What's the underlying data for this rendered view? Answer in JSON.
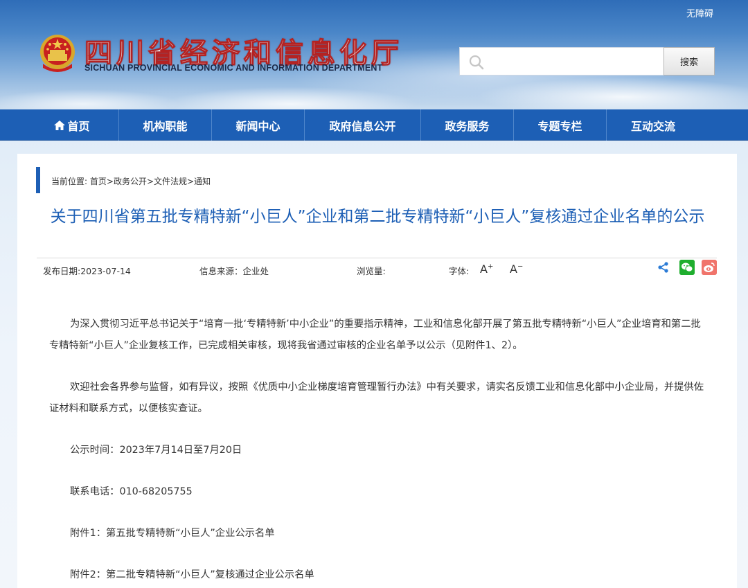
{
  "header": {
    "accessibility": "无障碍",
    "title_cn": "四川省经济和信息化厅",
    "title_en": "SICHUAN PROVINCIAL ECONOMIC AND INFORMATION DEPARTMENT",
    "search_placeholder": "",
    "search_button": "搜索"
  },
  "nav": {
    "items": [
      {
        "label": "首页",
        "icon": "home-icon"
      },
      {
        "label": "机构职能"
      },
      {
        "label": "新闻中心"
      },
      {
        "label": "政府信息公开"
      },
      {
        "label": "政务服务"
      },
      {
        "label": "专题专栏"
      },
      {
        "label": "互动交流"
      }
    ]
  },
  "breadcrumb": {
    "prefix": "当前位置:",
    "items": [
      "首页",
      "政务公开",
      "文件法规",
      "通知"
    ],
    "separator": ">"
  },
  "article": {
    "title": "关于四川省第五批专精特新“小巨人”企业和第二批专精特新“小巨人”复核通过企业名单的公示",
    "meta": {
      "publish_date": "发布日期:2023-07-14",
      "source": "信息来源：企业处",
      "views": "浏览量:",
      "font_label": "字体:",
      "font_increase": "A",
      "font_decrease": "A"
    },
    "paragraphs": [
      "为深入贯彻习近平总书记关于“培育一批‘专精特新’中小企业”的重要指示精神，工业和信息化部开展了第五批专精特新“小巨人”企业培育和第二批专精特新“小巨人”企业复核工作，已完成相关审核，现将我省通过审核的企业名单予以公示（见附件1、2）。",
      "欢迎社会各界参与监督，如有异议，按照《优质中小企业梯度培育管理暂行办法》中有关要求，请实名反馈工业和信息化部中小企业局，并提供佐证材料和联系方式，以便核实查证。",
      "公示时间：2023年7月14日至7月20日",
      "联系电话：010-68205755",
      "附件1：第五批专精特新“小巨人”企业公示名单",
      "附件2：第二批专精特新“小巨人”复核通过企业公示名单"
    ]
  },
  "colors": {
    "nav_bg": "#1d5fb5",
    "title_blue": "#1d5fb5",
    "wechat_green": "#1fae2e",
    "weibo_red": "#f0746b"
  }
}
